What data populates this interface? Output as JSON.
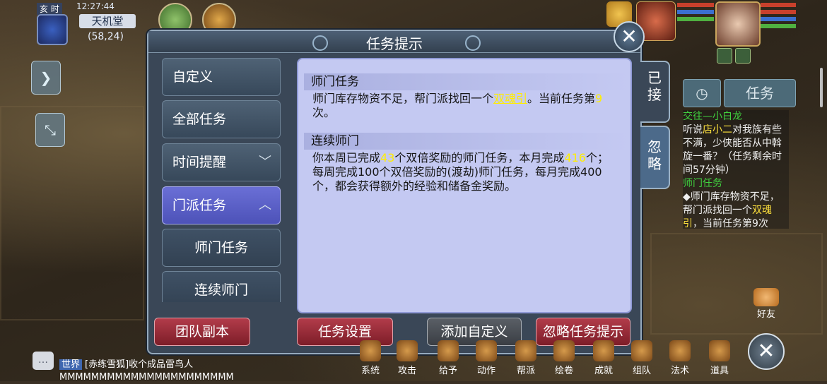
{
  "hud": {
    "time_tag": "亥 时",
    "clock": "12:27:44",
    "location": "天机堂",
    "coords": "(58,24)"
  },
  "dialog": {
    "title": "任务提示",
    "close_icon": "close-icon"
  },
  "menu": {
    "items": [
      {
        "label": "自定义",
        "state": "normal",
        "chevron": ""
      },
      {
        "label": "全部任务",
        "state": "normal",
        "chevron": ""
      },
      {
        "label": "时间提醒",
        "state": "normal",
        "chevron": "﹀"
      },
      {
        "label": "门派任务",
        "state": "active",
        "chevron": "︿"
      },
      {
        "label": "师门任务",
        "state": "sub",
        "chevron": ""
      },
      {
        "label": "连续师门",
        "state": "sub",
        "chevron": ""
      }
    ]
  },
  "content": {
    "sec1_title": "师门任务",
    "sec1_text_a": "师门库存物资不足，帮门派找回一个",
    "sec1_item": "双魂引",
    "sec1_text_b": "。当前任务第",
    "sec1_num": "9",
    "sec1_text_c": "次。",
    "sec2_title": "连续师门",
    "sec2_text_a": "你本周已完成",
    "sec2_num1": "43",
    "sec2_text_b": "个双倍奖励的师门任务，本月完成",
    "sec2_num2": "416",
    "sec2_text_c": "个；每周完成100个双倍奖励的(渡劫)师门任务，每月完成400个，都会获得额外的经验和储备金奖励。"
  },
  "side_tabs": {
    "accepted": "已接",
    "ignored": "忽略"
  },
  "buttons": {
    "team_dungeon": "团队副本",
    "task_settings": "任务设置",
    "add_custom": "添加自定义",
    "ignore_tips": "忽略任务提示"
  },
  "right_panel": {
    "clock_icon": "timer-icon",
    "task_label": "任务",
    "q1_title": "交往—小白龙",
    "q1_a": "听说",
    "q1_npc": "店小二",
    "q1_b": "对我族有些不满，少侠能否从中斡旋一番？（任务剩余时间57分钟）",
    "q2_title": "师门任务",
    "q2_a": "◆师门库存物资不足，帮门派找回一个",
    "q2_item": "双魂引",
    "q2_b": "，当前任务第9次"
  },
  "chat": {
    "channel": "世界",
    "text": "[赤练雪狐]收个成品雷鸟人MMMMMMMMMMMMMMMMMMMMMM"
  },
  "bottom_bar": {
    "items": [
      "系统",
      "攻击",
      "给予",
      "动作",
      "帮派",
      "绘卷",
      "成就",
      "组队",
      "法术",
      "道具"
    ],
    "friend": "好友"
  },
  "colors": {
    "accent_red": "#b23c4a",
    "active_purple": "#5a5fd0",
    "content_bg": "#c4c9f2",
    "quest_green": "#41d23f",
    "highlight_yellow": "#ffee00"
  }
}
